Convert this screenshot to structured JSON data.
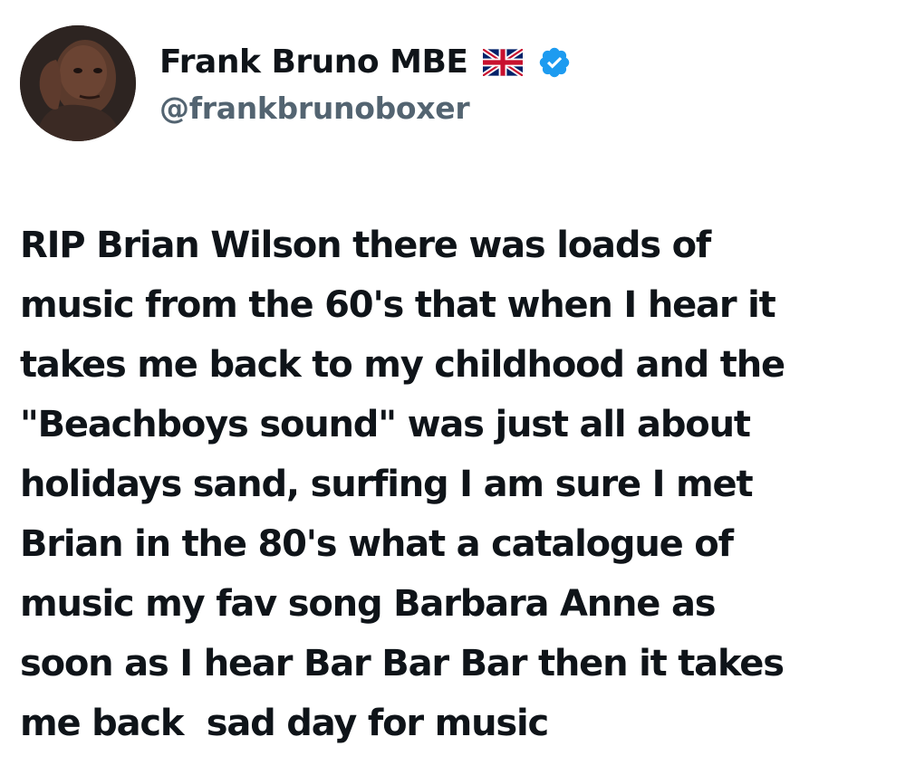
{
  "author": {
    "display_name": "Frank Bruno MBE",
    "handle": "@frankbrunoboxer",
    "flag_icon": "uk-flag-icon",
    "verified_icon": "verified-badge-icon",
    "verified_color": "#1d9bf0"
  },
  "tweet": {
    "lines": [
      "RIP Brian Wilson there was loads of",
      "music from the 60's that when I hear it",
      "takes me back to my childhood and the",
      "\"Beachboys sound\" was just all about",
      "holidays sand, surfing I am sure I met",
      "Brian in the 80's what a catalogue of",
      "music my fav song Barbara Anne as",
      "soon as I hear Bar Bar Bar then it takes",
      "me back  sad day for music"
    ]
  },
  "colors": {
    "text": "#0f1419",
    "handle": "#536471",
    "background": "#ffffff"
  }
}
